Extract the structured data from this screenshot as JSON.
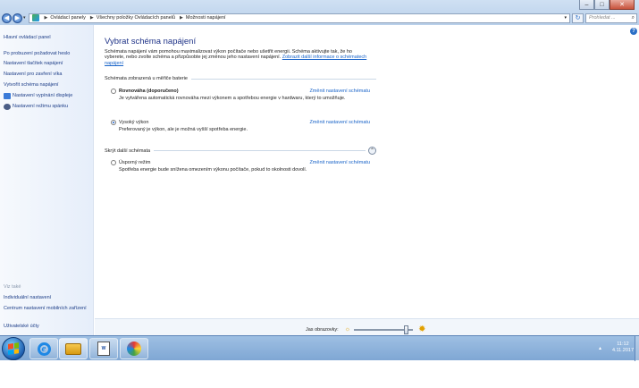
{
  "window": {
    "address_crumbs": [
      "Ovládací panely",
      "Všechny položky Ovládacích panelů",
      "Možnosti napájení"
    ],
    "search_placeholder": "Prohledat ..."
  },
  "sidebar": {
    "home": "Hlavní ovládací panel",
    "links": [
      "Po probuzení požadovat heslo",
      "Nastavení tlačítek napájení",
      "Nastavení pro zavření víka",
      "Vytvořit schéma napájení",
      "Nastavení vypínání displeje",
      "Nastavení režimu spánku"
    ],
    "see_also": "Viz také",
    "see_also_links": [
      "Individuální nastavení",
      "Centrum nastavení mobilních zařízení",
      "Uživatelské účty"
    ]
  },
  "main": {
    "title": "Vybrat schéma napájení",
    "intro": "Schémata napájení vám pomohou maximalizovat výkon počítače nebo ušetřit energii. Schéma aktivujte tak, že ho vyberete, nebo zvolte schéma a přizpůsobte jej změnou jeho nastavení napájení.",
    "intro_link": "Zobrazit další informace o schématech napájení",
    "section_battery": "Schémata zobrazená u měřiče baterie",
    "section_hidden": "Skrýt další schémata",
    "change_link": "Změnit nastavení schématu",
    "plans": [
      {
        "name": "Rovnováha (doporučeno)",
        "desc": "Je vytvářena automatická rovnováha mezi výkonem a spotřebou energie v hardwaru, který to umožňuje.",
        "selected": false
      },
      {
        "name": "Vysoký výkon",
        "desc": "Preferovaný je výkon, ale je možná vyšší spotřeba energie.",
        "selected": true
      },
      {
        "name": "Úsporný režim",
        "desc": "Spotřeba energie bude snížena omezením výkonu počítače, pokud to okolnosti dovolí.",
        "selected": false
      }
    ],
    "brightness_label": "Jas obrazovky:",
    "brightness_level": 0.88
  },
  "taskbar": {
    "time": "11:12",
    "date": "4.11.2017",
    "word_icon_text": "W"
  },
  "colors": {
    "link": "#1863c8",
    "title": "#1e3287",
    "sidebar_link": "#1b3c87"
  }
}
